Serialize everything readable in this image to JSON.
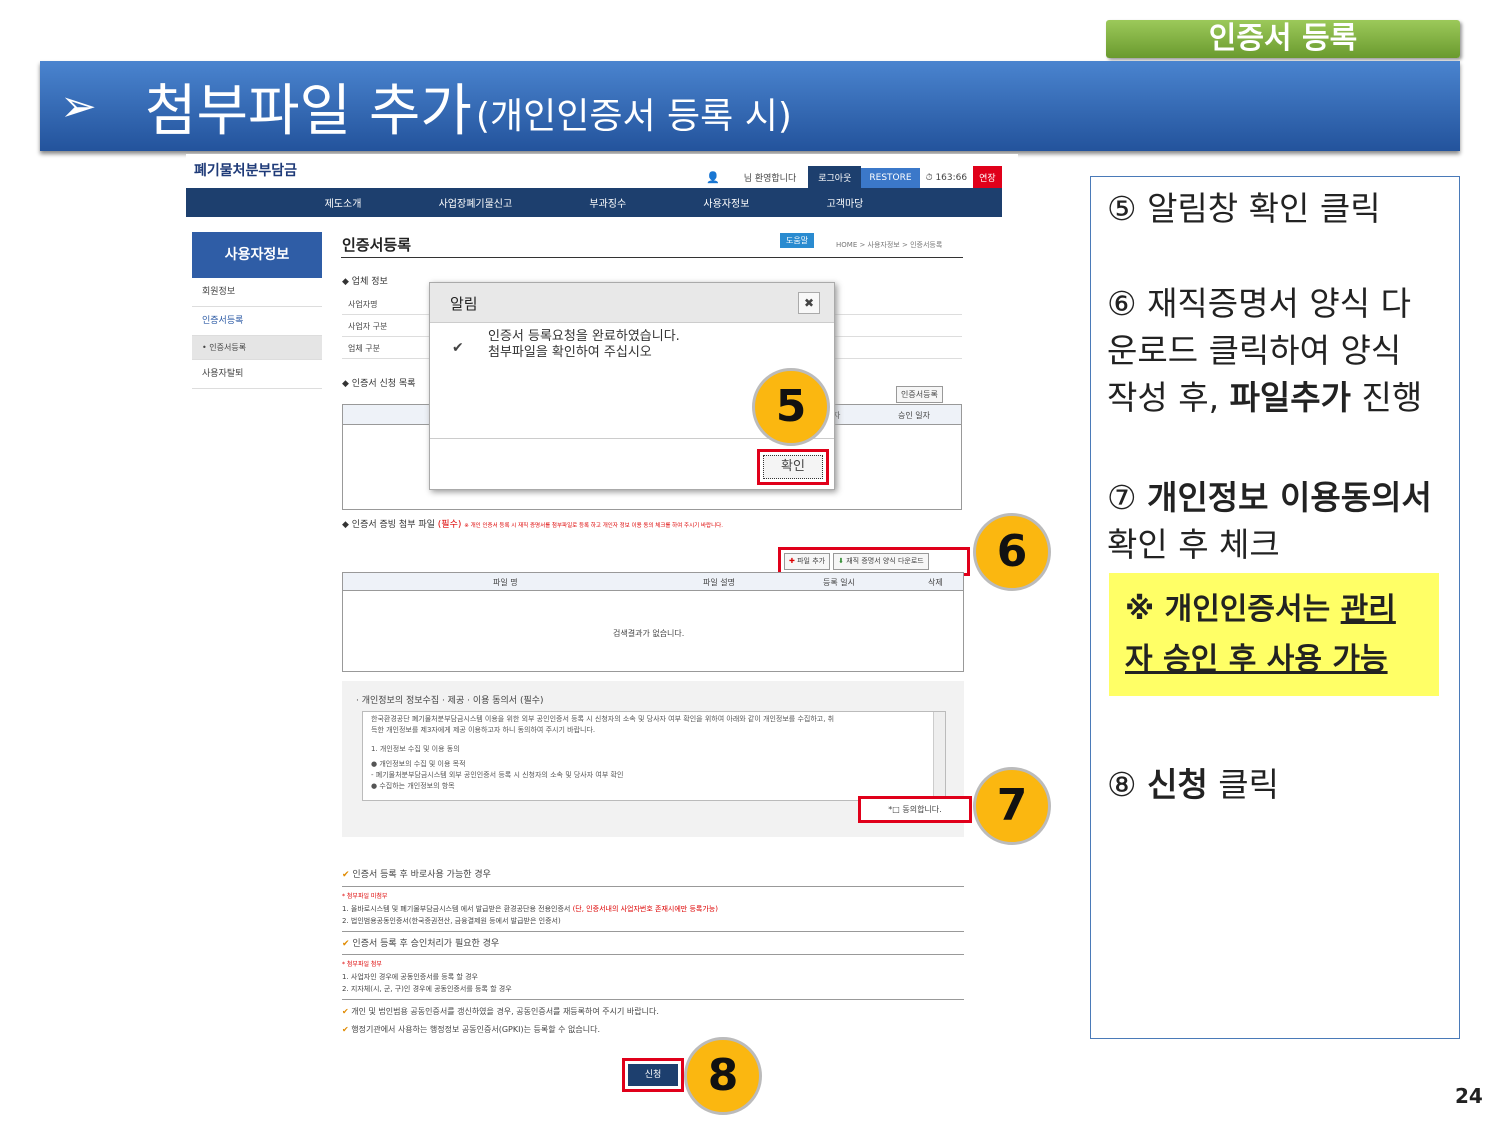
{
  "header": {
    "tag": "인증서 등록",
    "arrow": "➢",
    "title": "첨부파일 추가",
    "title_sub": "(개인인증서 등록 시)"
  },
  "side": {
    "step5": "⑤ 알림창 확인 클릭",
    "step6_a": "⑥ 재직증명서 양식 다",
    "step6_b": "운로드 클릭하여 양식",
    "step6_c1": "작성 후, ",
    "step6_c2": "파일추가",
    "step6_c3": " 진행",
    "step7_a1": "⑦ ",
    "step7_a2": "개인정보 이용동의서",
    "step7_b": "확인 후 체크",
    "note_a": "※ 개인인증서는 ",
    "note_b": "관리",
    "note_c": "자 승인 후 사용 가능",
    "step8_a": "⑧ ",
    "step8_b": "신청",
    "step8_c": " 클릭"
  },
  "page_number": "24",
  "shot": {
    "logo": "폐기물처분부담금",
    "welcome": "님 환영합니다",
    "logout": "로그아웃",
    "restore": "RESTORE",
    "timer": "⏱ 163:66",
    "extend": "연장",
    "nav": [
      "제도소개",
      "사업장폐기물신고",
      "부과징수",
      "사용자정보",
      "고객마당"
    ],
    "side_title": "사용자정보",
    "side_items": [
      "회원정보",
      "인증서등록",
      "• 인증서등록",
      "사용자탈퇴"
    ],
    "page_title": "인증서등록",
    "help": "도움말",
    "breadcrumb": "HOME > 사용자정보 > 인증서등록",
    "section_company": "업체 정보",
    "company_rows": [
      "사업자명",
      "사업자 구분",
      "업체 구분"
    ],
    "section_cert_list": "인증서 신청 목록",
    "cert_register_btn": "인증서등록",
    "cert_cols": [
      "자",
      "승인 일자"
    ],
    "dialog": {
      "title": "알림",
      "line1": "인증서 등록요청을 완료하였습니다.",
      "line2": "첨부파일을 확인하여 주십시오",
      "ok": "확인"
    },
    "attach_title": "인증서 증빙 첨부 파일",
    "attach_req": "(필수)",
    "attach_note": "※ 개인 인증서 등록 시 재직 증명서를 첨부파일로 등록 하고 개인자 정보 이용 동의 체크를 하여 주시기 바랍니다.",
    "add_file": "파일 추가",
    "download_form": "재직 증명서 양식 다운로드",
    "file_cols": [
      "파일 명",
      "파일 설명",
      "등록 일시",
      "삭제"
    ],
    "empty": "검색결과가 없습니다.",
    "consent_title": "· 개인정보의 정보수집 · 제공 · 이용 동의서 (필수)",
    "consent_text": [
      "한국환경공단 폐기물처분부담금시스템 이용을 위한 외부 공인인증서 등록 시 신청자의 소속 및 당사자 여부 확인을 위하여 아래와 같이 개인정보를 수집하고, 취",
      "득한 개인정보를 제3자에게 제공 이용하고자 하니 동의하여 주시기 바랍니다.",
      "1. 개인정보 수집 및 이용 동의",
      "● 개인정보의 수집 및 이용 목적",
      "- 폐기물처분부담금시스템 외부 공인인증서 등록 시 신청자의 소속 및 당사자 여부 확인",
      "● 수집하는 개인정보의 항목"
    ],
    "agree": "*□ 동의합니다.",
    "info1_title": "인증서 등록 후 바로사용 가능한 경우",
    "info1_sub": "* 첨부파일 미첨부",
    "info1_1a": "1. 올바로시스템 및 폐기물부담금시스템 에서 발급받은 환경공단용 전용인증서 ",
    "info1_1b": "(단, 인증서내의 사업자번호 존재시에만 등록가능)",
    "info1_2": "2. 법인범용공동인증서(한국증권전산, 금융결제원 등에서 발급받은 인증서)",
    "info2_title": "인증서 등록 후 승인처리가 필요한 경우",
    "info2_sub": "* 첨부파일 첨부",
    "info2_1": "1. 사업자인 경우에 공동인증서를 등록 할 경우",
    "info2_2": "2. 지자체(시, 군, 구)인 경우에 공동인증서를 등록 할 경우",
    "info3": "개인 및 법인범용 공동인증서를 갱신하였을 경우, 공동인증서를 재등록하여 주시기 바랍니다.",
    "info4": "행정기관에서 사용하는 행정정보 공동인증서(GPKI)는 등록할 수 없습니다.",
    "apply": "신청"
  },
  "markers": [
    "5",
    "6",
    "7",
    "8"
  ]
}
